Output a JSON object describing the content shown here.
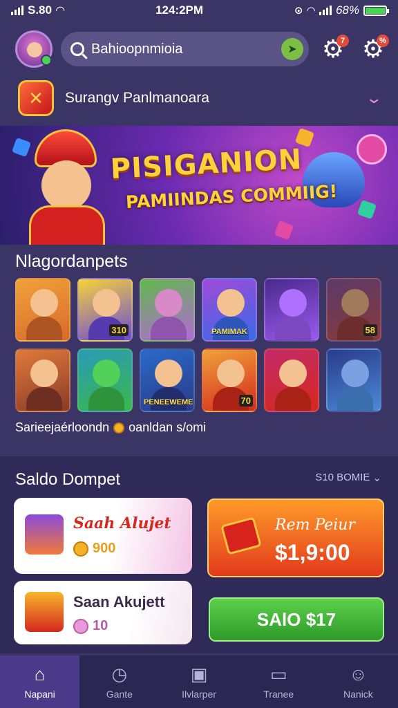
{
  "status": {
    "left": "S.80",
    "time": "124:2PM",
    "battery": "68%"
  },
  "header": {
    "search_value": "Bahioopnmioia",
    "badge_left": "7",
    "badge_right": "%"
  },
  "account": {
    "name": "Surangv Panlmanoara"
  },
  "banner": {
    "title": "PISIGANION",
    "subtitle": "PAMIINDAS COMMIIG!"
  },
  "games_section": {
    "title": "Nlagordanpets",
    "rows": [
      [
        {
          "tag": "",
          "num": ""
        },
        {
          "tag": "",
          "num": "310"
        },
        {
          "tag": "",
          "num": ""
        },
        {
          "tag": "PAMIMAK",
          "num": ""
        },
        {
          "tag": "",
          "num": ""
        },
        {
          "tag": "",
          "num": "58"
        }
      ],
      [
        {
          "tag": "",
          "num": ""
        },
        {
          "tag": "",
          "num": ""
        },
        {
          "tag": "PENEEWEMEK",
          "num": ""
        },
        {
          "tag": "",
          "num": "70"
        },
        {
          "tag": "",
          "num": ""
        },
        {
          "tag": "",
          "num": ""
        }
      ]
    ],
    "caption_left": "Sarieejaérloondn",
    "caption_right": "oanldan s/omi"
  },
  "wallet": {
    "title": "Saldo Dompet",
    "filter": "S10 BOMIE",
    "card1_name": "Saah Alujet",
    "card1_amount": "900",
    "card2_name": "Saan Akujett",
    "card2_amount": "10",
    "orange_label": "Rem Peiur",
    "orange_value": "$1,9:00",
    "green_button": "SAlO $17"
  },
  "tabs": [
    {
      "label": "Napani",
      "icon": "home-icon"
    },
    {
      "label": "Gante",
      "icon": "clock-icon"
    },
    {
      "label": "Ilvlarper",
      "icon": "bag-icon"
    },
    {
      "label": "Tranee",
      "icon": "tv-icon"
    },
    {
      "label": "Nanick",
      "icon": "profile-icon"
    }
  ],
  "colors": {
    "background": "#3b3565",
    "accent_green": "#47d64e",
    "accent_orange": "#ff9a2a"
  }
}
